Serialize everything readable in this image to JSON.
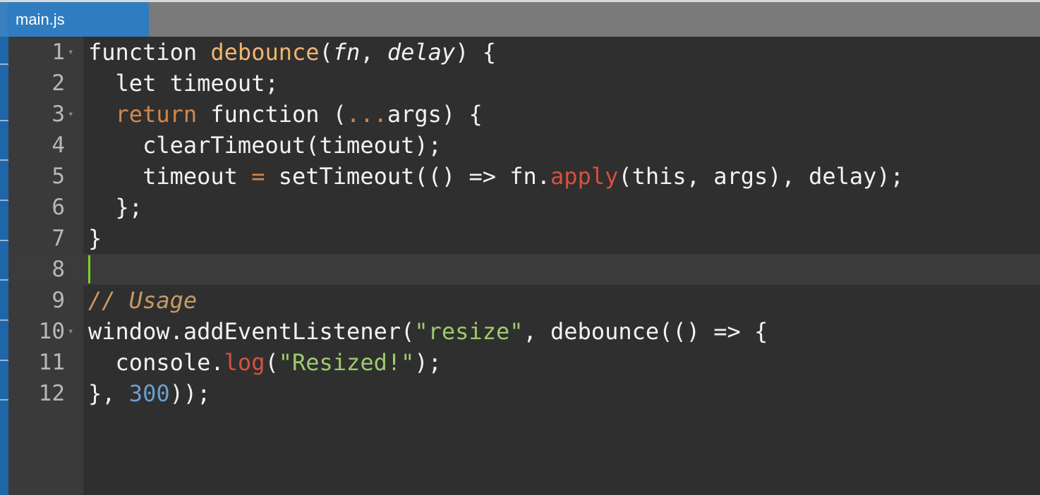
{
  "tab": {
    "title": "main.js"
  },
  "editor": {
    "lines": [
      {
        "number": "1",
        "fold": true
      },
      {
        "number": "2",
        "fold": false
      },
      {
        "number": "3",
        "fold": true
      },
      {
        "number": "4",
        "fold": false
      },
      {
        "number": "5",
        "fold": false
      },
      {
        "number": "6",
        "fold": false
      },
      {
        "number": "7",
        "fold": false
      },
      {
        "number": "8",
        "fold": false
      },
      {
        "number": "9",
        "fold": false
      },
      {
        "number": "10",
        "fold": true
      },
      {
        "number": "11",
        "fold": false
      },
      {
        "number": "12",
        "fold": false
      }
    ],
    "code": {
      "l1": {
        "kw": "function ",
        "name": "debounce",
        "open": "(",
        "p1": "fn",
        "comma": ", ",
        "p2": "delay",
        "close": ") {"
      },
      "l2": {
        "text": "  let timeout;"
      },
      "l3": {
        "indent": "  ",
        "kw": "return",
        "rest1": " function (",
        "spread": "...",
        "rest2": "args) {"
      },
      "l4": {
        "text": "    clearTimeout(timeout);"
      },
      "l5": {
        "a": "    timeout ",
        "op": "=",
        "b": " setTimeout(() => fn.",
        "method": "apply",
        "c": "(this, args), delay);"
      },
      "l6": {
        "text": "  };"
      },
      "l7": {
        "text": "}"
      },
      "l8": {
        "text": ""
      },
      "l9": {
        "comment": "// Usage"
      },
      "l10": {
        "a": "window.addEventListener(",
        "str": "\"resize\"",
        "b": ", debounce(() => {"
      },
      "l11": {
        "a": "  console.",
        "method": "log",
        "b": "(",
        "str": "\"Resized!\"",
        "c": ");"
      },
      "l12": {
        "a": "}, ",
        "num": "300",
        "b": "));"
      }
    }
  },
  "colors": {
    "tab_active": "#2f7dc0",
    "keyword": "#d4874a",
    "function_name": "#f2b56f",
    "method": "#d94f3f",
    "string": "#9fca6a",
    "number": "#6b9ecf",
    "comment": "#c89a62",
    "cursor": "#7ed321"
  }
}
